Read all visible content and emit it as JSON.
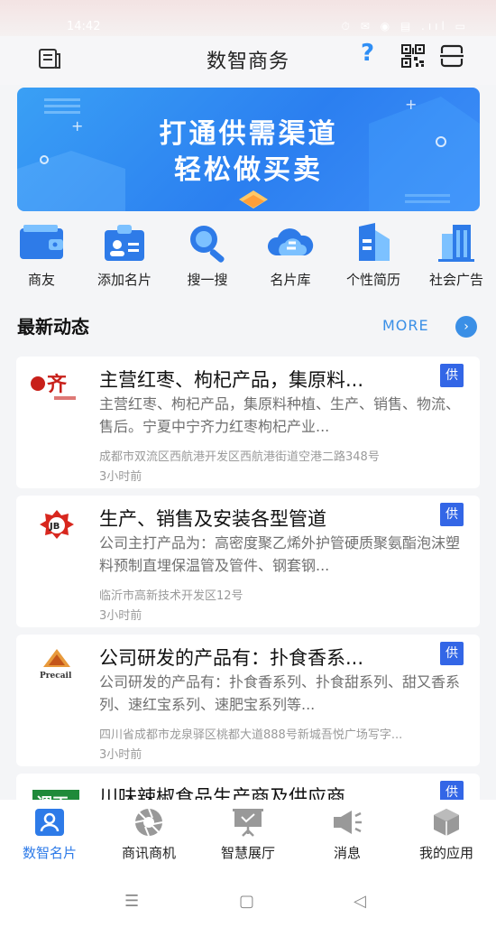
{
  "status_bar": {
    "time": "14:42",
    "icons": "⏱ ✉ ◉ ▤ .ııl ▭"
  },
  "header": {
    "title": "数智商务"
  },
  "banner": {
    "line1": "打通供需渠道",
    "line2": "轻松做买卖"
  },
  "quick_menu": [
    {
      "label": "商友",
      "icon": "wallet-icon"
    },
    {
      "label": "添加名片",
      "icon": "add-card-icon"
    },
    {
      "label": "搜一搜",
      "icon": "search-icon"
    },
    {
      "label": "名片库",
      "icon": "cloud-icon"
    },
    {
      "label": "个性简历",
      "icon": "resume-icon"
    },
    {
      "label": "社会广告",
      "icon": "buildings-icon"
    }
  ],
  "feed": {
    "title": "最新动态",
    "more": "MORE",
    "items": [
      {
        "title": "主营红枣、枸杞产品，集原料...",
        "tag": "供",
        "desc": "主营红枣、枸杞产品，集原料种植、生产、销售、物流、售后。宁夏中宁齐力红枣枸杞产业...",
        "address": "成都市双流区西航港开发区西航港街道空港二路348号",
        "time": "3小时前",
        "logo_text": "齐"
      },
      {
        "title": "生产、销售及安装各型管道",
        "tag": "供",
        "desc": "公司主打产品为：高密度聚乙烯外护管硬质聚氨酯泡沫塑料预制直埋保温管及管件、钢套钢...",
        "address": "临沂市高新技术开发区12号",
        "time": "3小时前",
        "logo_text": "JB"
      },
      {
        "title": "公司研发的产品有：扑食香系...",
        "tag": "供",
        "desc": "公司研发的产品有：扑食香系列、扑食甜系列、甜又香系列、速红宝系列、速肥宝系列等...",
        "address": "四川省成都市龙泉驿区桃都大道888号新城吾悦广场写字...",
        "time": "3小时前",
        "logo_text": "Precail"
      },
      {
        "title": "川味辣椒食品生产商及供应商",
        "tag": "供",
        "desc": "",
        "address": "",
        "time": "",
        "logo_text": "调正"
      }
    ]
  },
  "bottom_nav": [
    {
      "label": "数智名片",
      "icon": "person-card-icon",
      "active": true
    },
    {
      "label": "商讯商机",
      "icon": "aperture-icon",
      "active": false
    },
    {
      "label": "智慧展厅",
      "icon": "easel-icon",
      "active": false
    },
    {
      "label": "消息",
      "icon": "megaphone-icon",
      "active": false
    },
    {
      "label": "我的应用",
      "icon": "cube-icon",
      "active": false
    }
  ],
  "system_nav": {
    "menu": "☰",
    "home": "▢",
    "back": "◁"
  },
  "colors": {
    "accent": "#2e7be8",
    "tag_bg": "#3366e6",
    "banner": "#2b7ff0"
  }
}
